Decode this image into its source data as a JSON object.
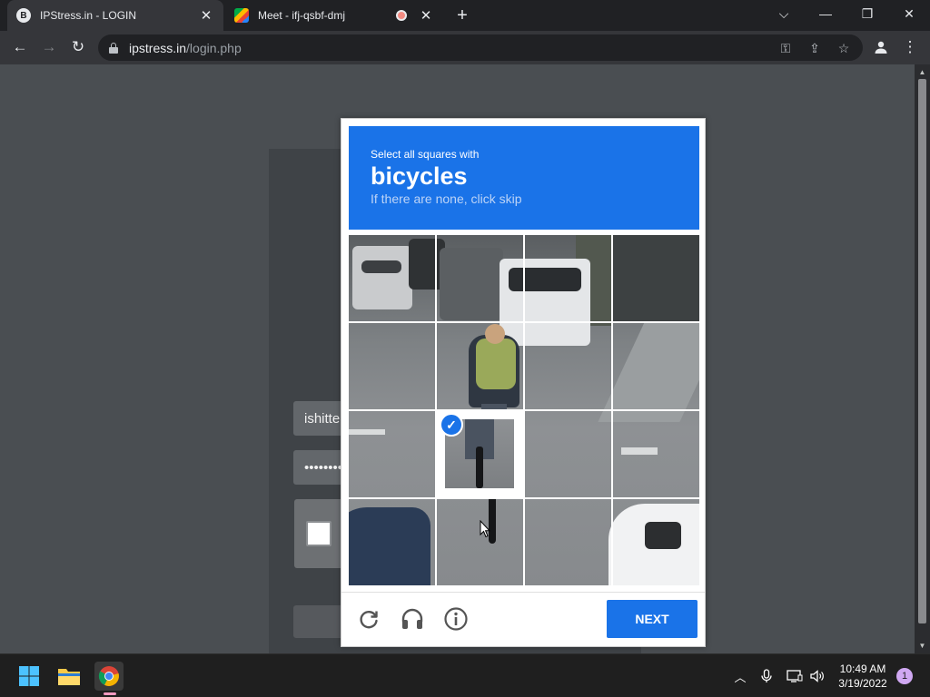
{
  "browser": {
    "tabs": [
      {
        "favicon": "B",
        "title": "IPStress.in - LOGIN",
        "close": "✕"
      },
      {
        "title": "Meet - ifj-qsbf-dmj",
        "close": "✕"
      }
    ],
    "newtab": "+",
    "window_controls": {
      "tabsearch": "⌵",
      "minimize": "—",
      "restore": "❐",
      "close": "✕"
    },
    "nav": {
      "back": "←",
      "forward": "→",
      "reload": "↻"
    },
    "url_host": "ipstress.in",
    "url_path": "/login.php",
    "omni_icons": {
      "key": "⚿",
      "share": "⇪",
      "star": "☆"
    },
    "menu": "⋮"
  },
  "page": {
    "username_value": "ishitte",
    "password_value": "••••••••"
  },
  "captcha": {
    "instruction": "Select all squares with",
    "target": "bicycles",
    "hint": "If there are none, click skip",
    "selected_tiles": [
      5
    ],
    "next_label": "NEXT",
    "check": "✓",
    "icons": [
      "reload-icon",
      "audio-icon",
      "info-icon"
    ]
  },
  "taskbar": {
    "time": "10:49 AM",
    "date": "3/19/2022",
    "notifications": "1",
    "tray_chevron": "︿"
  },
  "colors": {
    "accent": "#1a73e8",
    "chrome_dark": "#202124",
    "chrome_toolbar": "#35363a"
  }
}
